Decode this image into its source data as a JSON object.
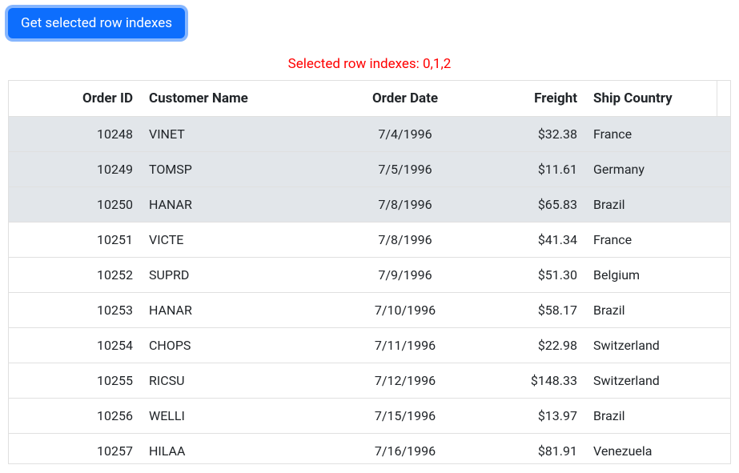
{
  "button": {
    "label": "Get selected row indexes"
  },
  "status": {
    "prefix": "Selected row indexes: ",
    "indexes": "0,1,2"
  },
  "grid": {
    "headers": {
      "orderId": "Order ID",
      "customerName": "Customer Name",
      "orderDate": "Order Date",
      "freight": "Freight",
      "shipCountry": "Ship Country"
    },
    "selectedRows": [
      0,
      1,
      2
    ],
    "rows": [
      {
        "orderId": "10248",
        "customerName": "VINET",
        "orderDate": "7/4/1996",
        "freight": "$32.38",
        "shipCountry": "France"
      },
      {
        "orderId": "10249",
        "customerName": "TOMSP",
        "orderDate": "7/5/1996",
        "freight": "$11.61",
        "shipCountry": "Germany"
      },
      {
        "orderId": "10250",
        "customerName": "HANAR",
        "orderDate": "7/8/1996",
        "freight": "$65.83",
        "shipCountry": "Brazil"
      },
      {
        "orderId": "10251",
        "customerName": "VICTE",
        "orderDate": "7/8/1996",
        "freight": "$41.34",
        "shipCountry": "France"
      },
      {
        "orderId": "10252",
        "customerName": "SUPRD",
        "orderDate": "7/9/1996",
        "freight": "$51.30",
        "shipCountry": "Belgium"
      },
      {
        "orderId": "10253",
        "customerName": "HANAR",
        "orderDate": "7/10/1996",
        "freight": "$58.17",
        "shipCountry": "Brazil"
      },
      {
        "orderId": "10254",
        "customerName": "CHOPS",
        "orderDate": "7/11/1996",
        "freight": "$22.98",
        "shipCountry": "Switzerland"
      },
      {
        "orderId": "10255",
        "customerName": "RICSU",
        "orderDate": "7/12/1996",
        "freight": "$148.33",
        "shipCountry": "Switzerland"
      },
      {
        "orderId": "10256",
        "customerName": "WELLI",
        "orderDate": "7/15/1996",
        "freight": "$13.97",
        "shipCountry": "Brazil"
      },
      {
        "orderId": "10257",
        "customerName": "HILAA",
        "orderDate": "7/16/1996",
        "freight": "$81.91",
        "shipCountry": "Venezuela"
      }
    ]
  }
}
